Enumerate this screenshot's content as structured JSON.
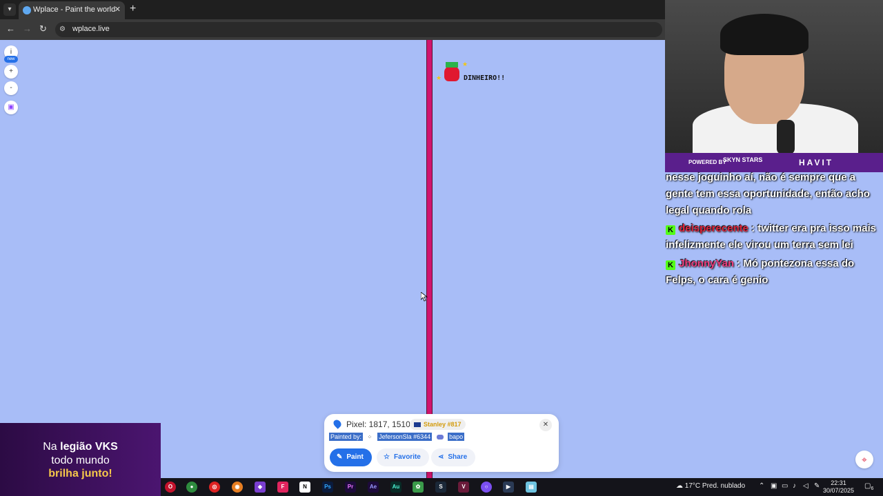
{
  "browser": {
    "tab_title": "Wplace - Paint the world",
    "url": "wplace.live"
  },
  "sidebar": {
    "info_label": "i",
    "new_badge": "new",
    "zoom_in": "+",
    "zoom_out": "-"
  },
  "map_art": {
    "text": "DINHEIRO!!"
  },
  "pixel_popup": {
    "coords_label": "Pixel: 1817, 1510",
    "alliance": "Stanley #817",
    "painted_by_label": "Painted by:",
    "painter": "JefersonSla #6344",
    "painter_alliance": "bapo",
    "paint_button": "Paint",
    "favorite_button": "Favorite",
    "share_button": "Share"
  },
  "stream_overlay": {
    "powered_by": "POWERED BY",
    "sponsor_1": "SKYN STARS",
    "sponsor_2": "HAVIT",
    "chat": [
      {
        "user": "",
        "message": "nesse joguinho aí, não é sempre que a gente tem essa oportunidade, então acho legal quando rola"
      },
      {
        "user": "deisperecente",
        "message": ": twitter era pra isso mais infelizmente ele virou um terra sem lei"
      },
      {
        "user": "JhonnyYan",
        "message": ": Mó pontezona essa do Felps, o cara é genio"
      }
    ],
    "promo": {
      "line1_pre": "Na ",
      "line1_bold": "legião VKS",
      "line2": "todo mundo",
      "line3": "brilha junto!"
    }
  },
  "taskbar": {
    "weather": "17°C  Pred. nublado",
    "time": "22:31",
    "date": "30/07/2025",
    "notification_count": "6",
    "apps": [
      "Ps",
      "Pr",
      "Ae",
      "Au"
    ]
  },
  "colors": {
    "map_bg": "#a8bdf7",
    "line_pink": "#d0146e",
    "accent_blue": "#2470e8",
    "overlay_purple": "#5a1f8c"
  }
}
